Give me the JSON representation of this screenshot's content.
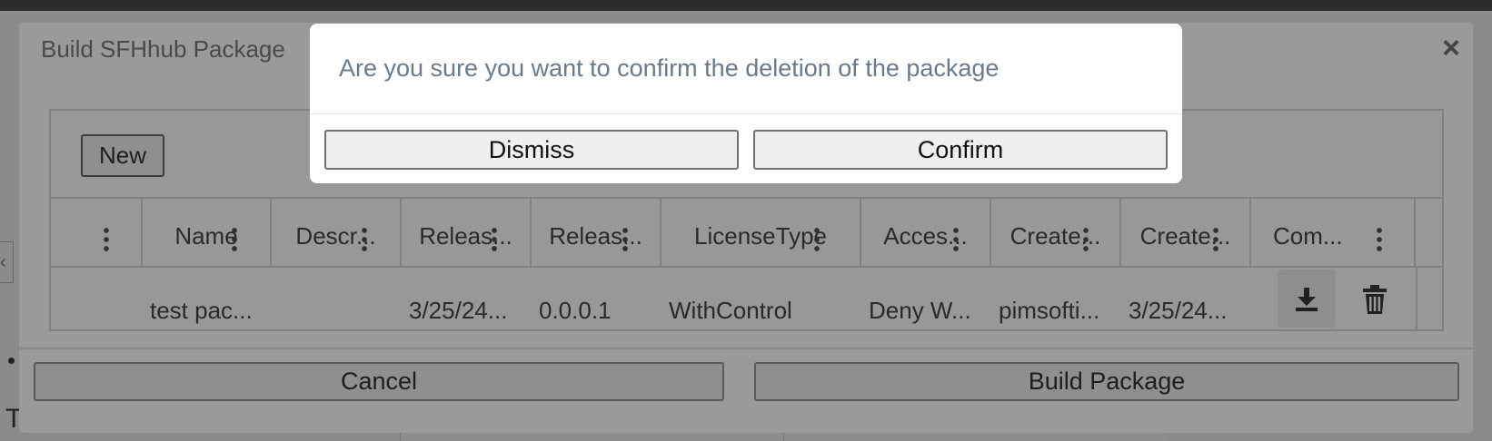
{
  "background_page": {
    "partial_letter": "T"
  },
  "dialog": {
    "title": "Build SFHhub Package",
    "close_icon": "close-icon",
    "new_button_label": "New",
    "columns": [
      "Name",
      "Descr...",
      "Releas...",
      "Releas...",
      "LicenseType",
      "Acces...",
      "Create...",
      "Create...",
      "Com..."
    ],
    "rows": [
      {
        "cells": [
          "test pac...",
          "",
          "3/25/24...",
          "0.0.0.1",
          "WithControl",
          "Deny W...",
          "pimsofti...",
          "3/25/24..."
        ],
        "actions": [
          "download-icon",
          "trash-icon"
        ]
      }
    ],
    "cancel_label": "Cancel",
    "build_label": "Build Package"
  },
  "confirm_modal": {
    "message": "Are you sure you want to confirm the deletion of the package",
    "dismiss_label": "Dismiss",
    "confirm_label": "Confirm"
  },
  "colors": {
    "overlay": "#8b8b8b",
    "modal_bg": "#ffffff",
    "modal_text": "#6b7a8a",
    "button_bg": "#efefef"
  }
}
